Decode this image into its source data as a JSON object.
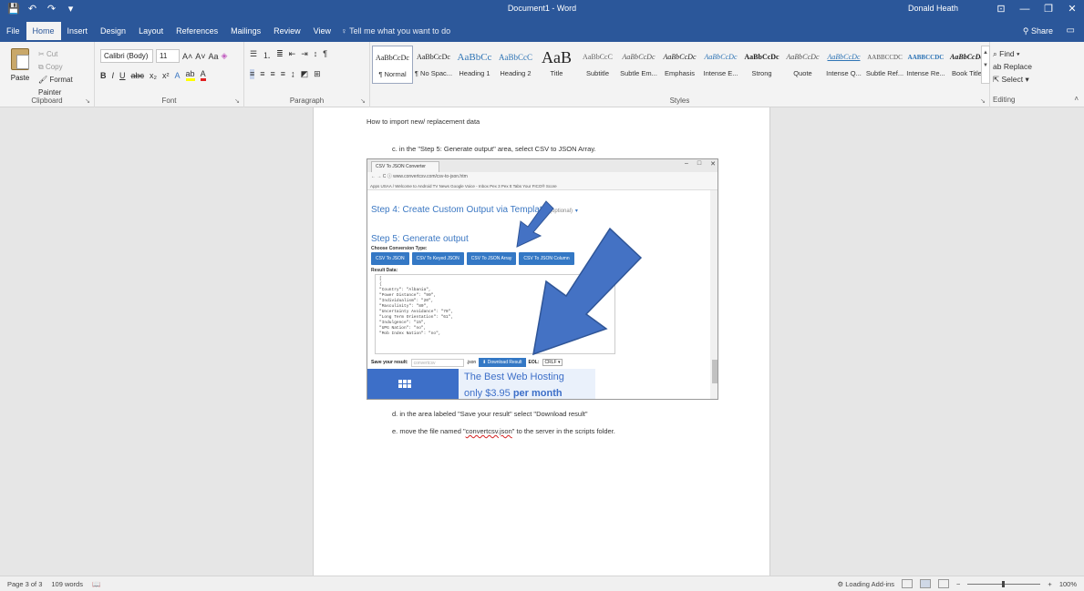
{
  "window": {
    "title": "Document1 - Word",
    "user": "Donald Heath",
    "buttons": [
      "⊡",
      "—",
      "❐",
      "✕"
    ]
  },
  "qat": [
    "💾",
    "↶",
    "↷",
    "▾"
  ],
  "tabs": [
    {
      "label": "File"
    },
    {
      "label": "Home"
    },
    {
      "label": "Insert"
    },
    {
      "label": "Design"
    },
    {
      "label": "Layout"
    },
    {
      "label": "References"
    },
    {
      "label": "Mailings"
    },
    {
      "label": "Review"
    },
    {
      "label": "View"
    }
  ],
  "tellme": "Tell me what you want to do",
  "share": "Share",
  "ribbon": {
    "clipboard": {
      "paste": "Paste",
      "cut": "Cut",
      "copy": "Copy",
      "format_painter": "Format Painter",
      "label": "Clipboard"
    },
    "font": {
      "name": "Calibri (Body)",
      "size": "11",
      "label": "Font"
    },
    "paragraph": {
      "label": "Paragraph"
    },
    "styles": {
      "label": "Styles",
      "items": [
        {
          "sample": "AaBbCcDc",
          "name": "¶ Normal"
        },
        {
          "sample": "AaBbCcDc",
          "name": "¶ No Spac..."
        },
        {
          "sample": "AaBbCc",
          "name": "Heading 1"
        },
        {
          "sample": "AaBbCcC",
          "name": "Heading 2"
        },
        {
          "sample": "AaB",
          "name": "Title"
        },
        {
          "sample": "AaBbCcC",
          "name": "Subtitle"
        },
        {
          "sample": "AaBbCcDc",
          "name": "Subtle Em..."
        },
        {
          "sample": "AaBbCcDc",
          "name": "Emphasis"
        },
        {
          "sample": "AaBbCcDc",
          "name": "Intense E..."
        },
        {
          "sample": "AaBbCcDc",
          "name": "Strong"
        },
        {
          "sample": "AaBbCcDc",
          "name": "Quote"
        },
        {
          "sample": "AaBbCcDc",
          "name": "Intense Q..."
        },
        {
          "sample": "AABBCCDC",
          "name": "Subtle Ref..."
        },
        {
          "sample": "AABBCCDC",
          "name": "Intense Re..."
        },
        {
          "sample": "AaBbCcDc",
          "name": "Book Title"
        }
      ]
    },
    "editing": {
      "find": "Find",
      "replace": "Replace",
      "select": "Select",
      "label": "Editing"
    }
  },
  "document": {
    "heading": "How to import new/ replacement data",
    "step_c": "c. in the \"Step 5: Generate output\" area, select CSV to JSON Array.",
    "step_d": "d. in the area labeled \"Save your result\" select \"Download result\"",
    "step_e_prefix": "e. move the file named \"",
    "step_e_file": "convertcsv.json",
    "step_e_suffix": "\" to the server in the scripts folder."
  },
  "screenshot": {
    "tab": "CSV To JSON Converter",
    "url": "www.convertcsv.com/csv-to-json.htm",
    "bookmarks": "Apps   USAA / Welcome to   Android TV News   Google Voice - Inbox   Pex   3 Pex tt   Tabs   Your FICO® Score",
    "step4": "Step 4: Create Custom Output via Template",
    "step4_opt": "(optional)",
    "step5": "Step 5: Generate output",
    "choose": "Choose Conversion Type:",
    "buttons": [
      "CSV To JSON",
      "CSV To Keyed JSON",
      "CSV To JSON Array",
      "CSV To JSON Column"
    ],
    "result_label": "Result Data:",
    "result_lines": [
      "[",
      " {",
      "  \"Country\": \"Albania\",",
      "  \"Power Distance\": \"90\",",
      "  \"Individualism\": \"20\",",
      "  \"Masculinity\": \"80\",",
      "  \"Uncertainty Avoidance\": \"70\",",
      "  \"Long Term Orientation\": \"61\",",
      "  \"Indulgence\": \"15\",",
      "  \"UPG Nation\": \"no\",",
      "  \"Mob Index Nation\": \"no\","
    ],
    "save_label": "Save your result:",
    "save_value": "convertcsv",
    "save_ext": ".json",
    "download": "Download Result",
    "eol_label": "EOL:",
    "eol_value": "CRLF",
    "ad_line1": "The Best Web Hosting",
    "ad_line2_prefix": "only  $3.95 ",
    "ad_line2_bold": "per month"
  },
  "status": {
    "page": "Page 3 of 3",
    "words": "109 words",
    "addins": "Loading Add-ins",
    "zoom": "100%"
  },
  "colors": {
    "word_blue": "#2b579a",
    "arrow_blue": "#4472c4",
    "site_blue": "#3478c5"
  }
}
